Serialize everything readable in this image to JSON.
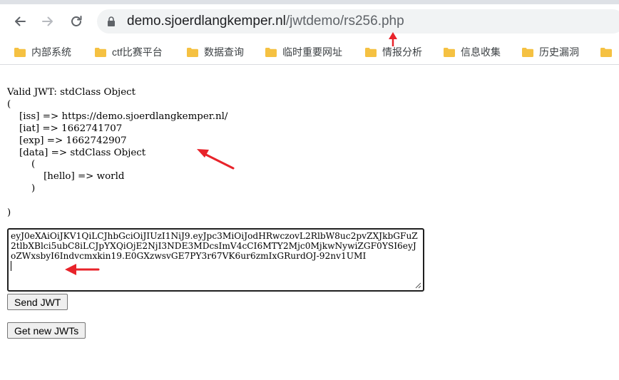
{
  "browser": {
    "url_host": "demo.sjoerdlangkemper.nl",
    "url_path": "/jwtdemo/rs256.php",
    "bookmarks": [
      {
        "label": "内部系统",
        "icon": "folder-icon"
      },
      {
        "label": "ctf比赛平台",
        "icon": "folder-icon"
      },
      {
        "label": "数据查询",
        "icon": "folder-icon"
      },
      {
        "label": "临时重要网址",
        "icon": "folder-icon"
      },
      {
        "label": "情报分析",
        "icon": "folder-icon"
      },
      {
        "label": "信息收集",
        "icon": "folder-icon"
      },
      {
        "label": "历史漏洞",
        "icon": "folder-icon"
      }
    ]
  },
  "page": {
    "dump": "Valid JWT: stdClass Object\n(\n    [iss] => https://demo.sjoerdlangkemper.nl/\n    [iat] => 1662741707\n    [exp] => 1662742907\n    [data] => stdClass Object\n        (\n            [hello] => world\n        )\n\n)",
    "jwt_value": "eyJ0eXAiOiJKV1QiLCJhbGciOiJIUzI1NiJ9.eyJpc3MiOiJodHRwczovL2RlbW8uc2pvZXJkbGFuZ2tlbXBlci5ubC8iLCJpYXQiOjE2NjI3NDE3MDcsImV4cCI6MTY2Mjc0MjkwNywiZGF0YSI6eyJoZWxsbyI6Indvcmxkin19.E0GXzwsvGE7PY3r67VK6ur6zmIxGRurdOJ-92nv1UMI",
    "send_button": "Send JWT",
    "new_button": "Get new JWTs"
  },
  "colors": {
    "annotation_arrow": "#e8232a",
    "folder": "#f5c142"
  }
}
